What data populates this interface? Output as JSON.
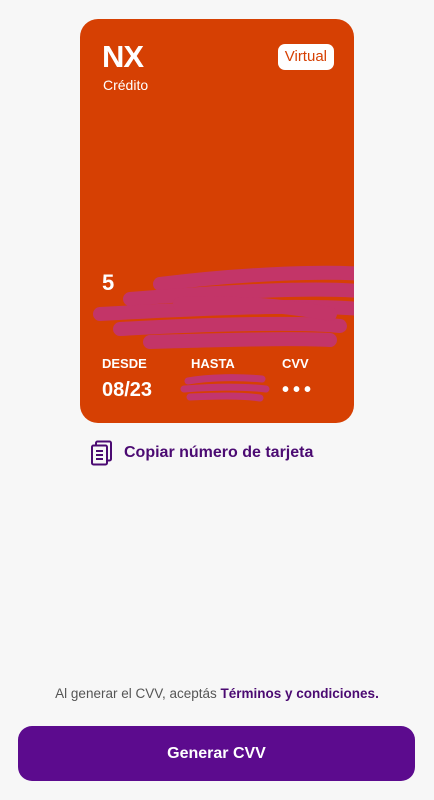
{
  "card": {
    "brand": "NX",
    "type": "Crédito",
    "badge": "Virtual",
    "number_visible": "5",
    "desde_label": "DESDE",
    "desde_value": "08/23",
    "hasta_label": "HASTA",
    "hasta_value": "",
    "cvv_label": "CVV",
    "cvv_value": "•••",
    "color": "#d64003"
  },
  "copy_action": {
    "label": "Copiar número de tarjeta",
    "icon": "copy-icon"
  },
  "terms": {
    "prefix": "Al generar el CVV, aceptás ",
    "link": "Términos y condiciones."
  },
  "cta": {
    "label": "Generar CVV",
    "color": "#5c0b8e"
  },
  "accent_color": "#4b0a72"
}
